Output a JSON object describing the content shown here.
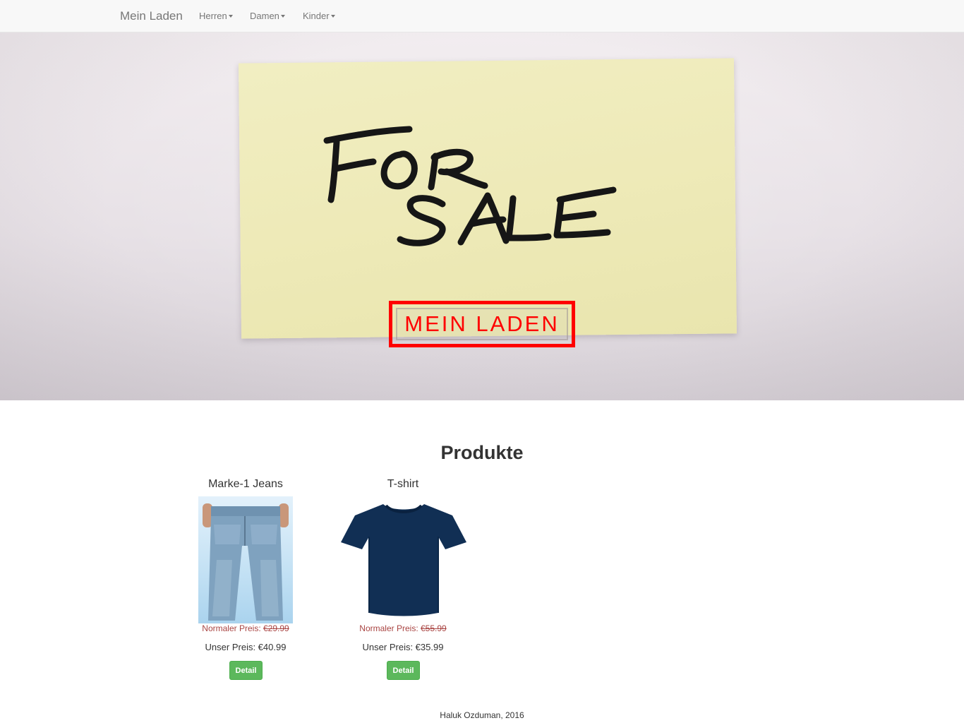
{
  "navbar": {
    "brand": "Mein Laden",
    "menus": [
      {
        "label": "Herren"
      },
      {
        "label": "Damen"
      },
      {
        "label": "Kinder"
      }
    ]
  },
  "hero": {
    "title": "MEIN LADEN",
    "note_text": "FOR SALE"
  },
  "products_section": {
    "title": "Produkte",
    "items": [
      {
        "name": "Marke-1 Jeans",
        "normal_price_label": "Normaler Preis:",
        "normal_price": "€29.99",
        "our_price": "Unser Preis: €40.99",
        "button": "Detail"
      },
      {
        "name": "T-shirt",
        "normal_price_label": "Normaler Preis:",
        "normal_price": "€55.99",
        "our_price": "Unser Preis: €35.99",
        "button": "Detail"
      }
    ]
  },
  "footer": {
    "text": "Haluk Ozduman, 2016"
  },
  "colors": {
    "accent_red": "#ff0000",
    "price_red": "#a94442",
    "button_green": "#5cb85c"
  }
}
